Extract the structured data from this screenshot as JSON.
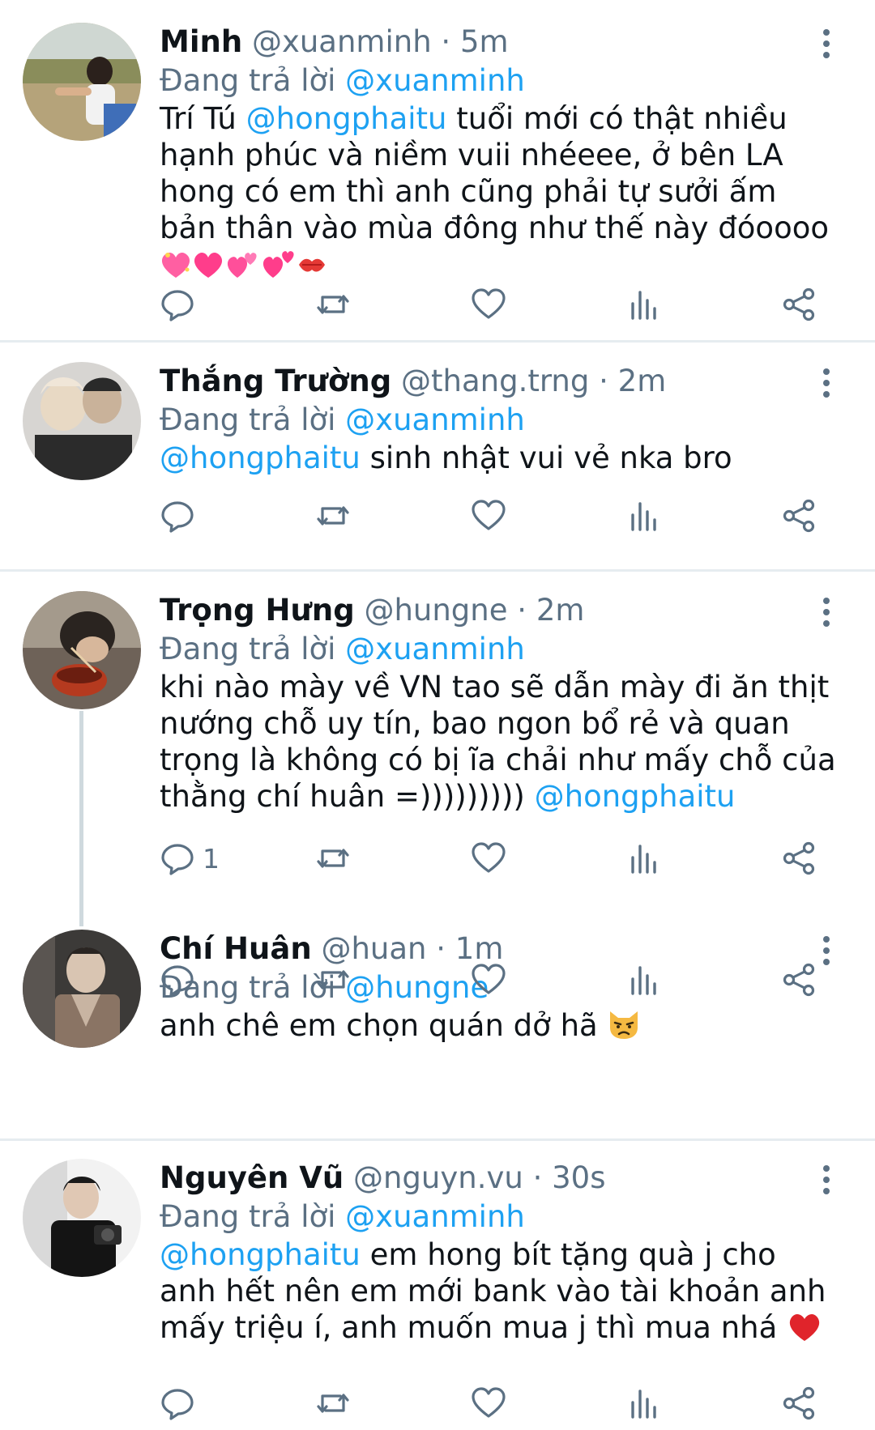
{
  "labels": {
    "replying_to": "Đang trả lời",
    "separator": "·"
  },
  "tweets": [
    {
      "name": "Minh",
      "handle": "@xuanminh",
      "time": "5m",
      "reply_to": "@xuanminh",
      "body": {
        "p1": "Trí Tú ",
        "m1": "@hongphaitu",
        "p2": " tuổi mới có thật nhiều hạnh phúc và niềm vuii nhéeee, ở bên LA hong có em thì anh cũng phải tự sưởi ấm bản thân vào mùa đông như thế này đóoooo"
      },
      "emojis": [
        "sparkling-heart",
        "pink-heart",
        "revolving-hearts",
        "two-hearts",
        "kiss-mark"
      ],
      "reply_count": ""
    },
    {
      "name": "Thắng Trường",
      "handle": "@thang.trng",
      "time": "2m",
      "reply_to": "@xuanminh",
      "body": {
        "m1": "@hongphaitu",
        "p1": " sinh nhật vui vẻ nka bro"
      },
      "reply_count": ""
    },
    {
      "name": "Trọng Hưng",
      "handle": "@hungne",
      "time": "2m",
      "reply_to": "@xuanminh",
      "body": {
        "p1": "khi nào mày về VN tao sẽ dẫn mày đi ăn thịt nướng chỗ uy tín, bao ngon bổ rẻ và quan trọng là không có bị ĩa chải như mấy chỗ của thằng chí huân =))))))))) ",
        "m1": "@hongphaitu"
      },
      "reply_count": "1"
    },
    {
      "name": "Chí Huân",
      "handle": "@huan",
      "time": "1m",
      "reply_to": "@hungne",
      "body": {
        "p1": "anh chê em chọn quán dở hã "
      },
      "emojis": [
        "pouting-cat"
      ],
      "reply_count": ""
    },
    {
      "name": "Nguyên Vũ",
      "handle": "@nguyn.vu",
      "time": "30s",
      "reply_to": "@xuanminh",
      "body": {
        "m1": "@hongphaitu",
        "p1": " em hong bít tặng quà j cho anh hết nên em mới bank vào tài khoản anh mấy triệu í, anh muốn mua j thì mua nhá "
      },
      "emojis": [
        "red-heart"
      ],
      "reply_count": ""
    }
  ],
  "colors": {
    "accent": "#1da1f2",
    "secondary": "#5b7083",
    "text": "#0f1419",
    "divider": "#e6ecf0",
    "thread": "#cfd9de"
  }
}
